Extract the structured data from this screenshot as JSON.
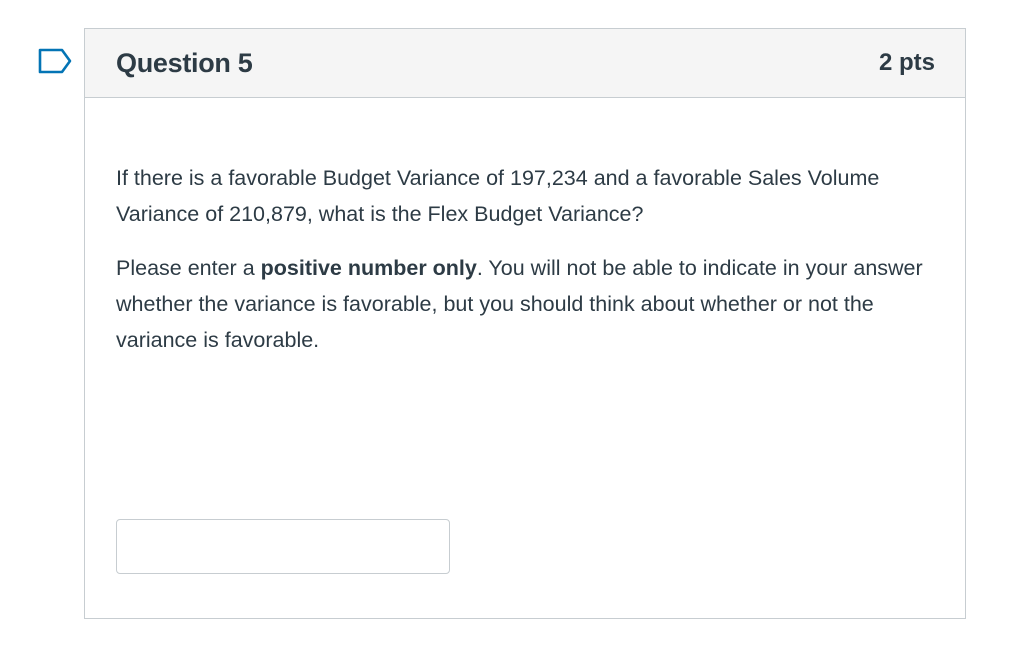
{
  "question": {
    "title": "Question 5",
    "points": "2 pts",
    "flag_icon": "bookmark-flag-icon",
    "flag_color": "#0374b5",
    "paragraph1": "If there is a favorable Budget Variance of 197,234 and a favorable Sales Volume Variance of 210,879, what is the Flex Budget Variance?",
    "paragraph2_before": "Please enter a ",
    "paragraph2_bold": "positive number only",
    "paragraph2_after": ". You will not be able to indicate in your answer whether the variance is favorable, but you should think about whether or not the variance is favorable.",
    "answer": {
      "value": "",
      "placeholder": ""
    }
  },
  "colors": {
    "header_bg": "#f5f5f5",
    "border": "#c7cdd1",
    "text": "#2d3b45"
  }
}
